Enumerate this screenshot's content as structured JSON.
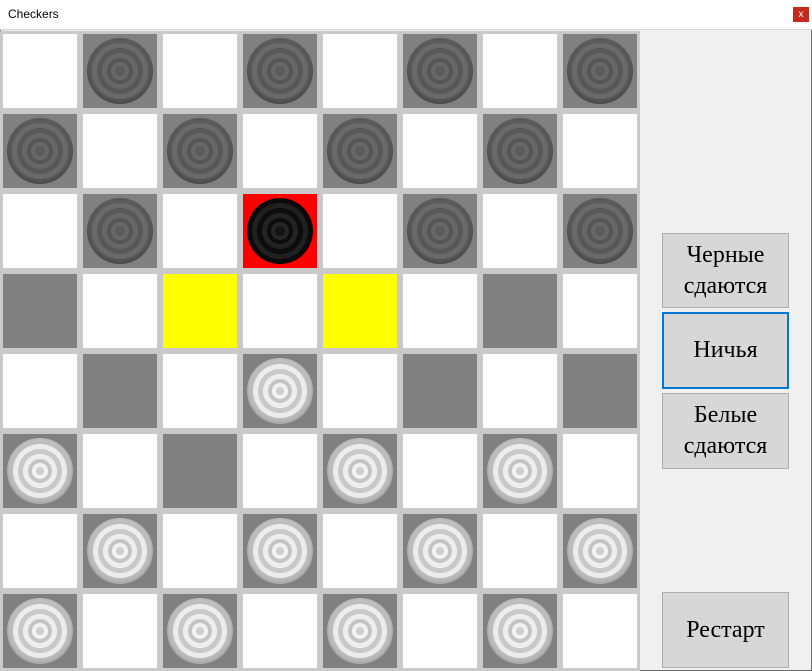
{
  "window": {
    "title": "Checkers",
    "close_label": "x"
  },
  "board": {
    "rows": [
      [
        "light",
        "dark:bd",
        "light",
        "dark:bd",
        "light",
        "dark:bd",
        "light",
        "dark:bd"
      ],
      [
        "dark:bd",
        "light",
        "dark:bd",
        "light",
        "dark:bd",
        "light",
        "dark:bd",
        "light"
      ],
      [
        "light",
        "dark:bd",
        "light",
        "selected:b",
        "light",
        "dark:bd",
        "light",
        "dark:bd"
      ],
      [
        "dark",
        "light",
        "highlight",
        "light",
        "highlight",
        "light",
        "dark",
        "light"
      ],
      [
        "light",
        "dark",
        "light",
        "dark:w",
        "light",
        "dark",
        "light",
        "dark"
      ],
      [
        "dark:w",
        "light",
        "dark",
        "light",
        "dark:w",
        "light",
        "dark:w",
        "light"
      ],
      [
        "light",
        "dark:w",
        "light",
        "dark:w",
        "light",
        "dark:w",
        "light",
        "dark:w"
      ],
      [
        "dark:w",
        "light",
        "dark:w",
        "light",
        "dark:w",
        "light",
        "dark:w",
        "light"
      ]
    ]
  },
  "buttons": {
    "black_surrender": "Черные сдаются",
    "draw": "Ничья",
    "white_surrender": "Белые сдаются",
    "restart": "Рестарт"
  },
  "colors": {
    "dark_square": "#808080",
    "light_square": "#ffffff",
    "highlight_square": "#ffff00",
    "selected_square": "#ff0000",
    "focus_border": "#0078d7"
  }
}
